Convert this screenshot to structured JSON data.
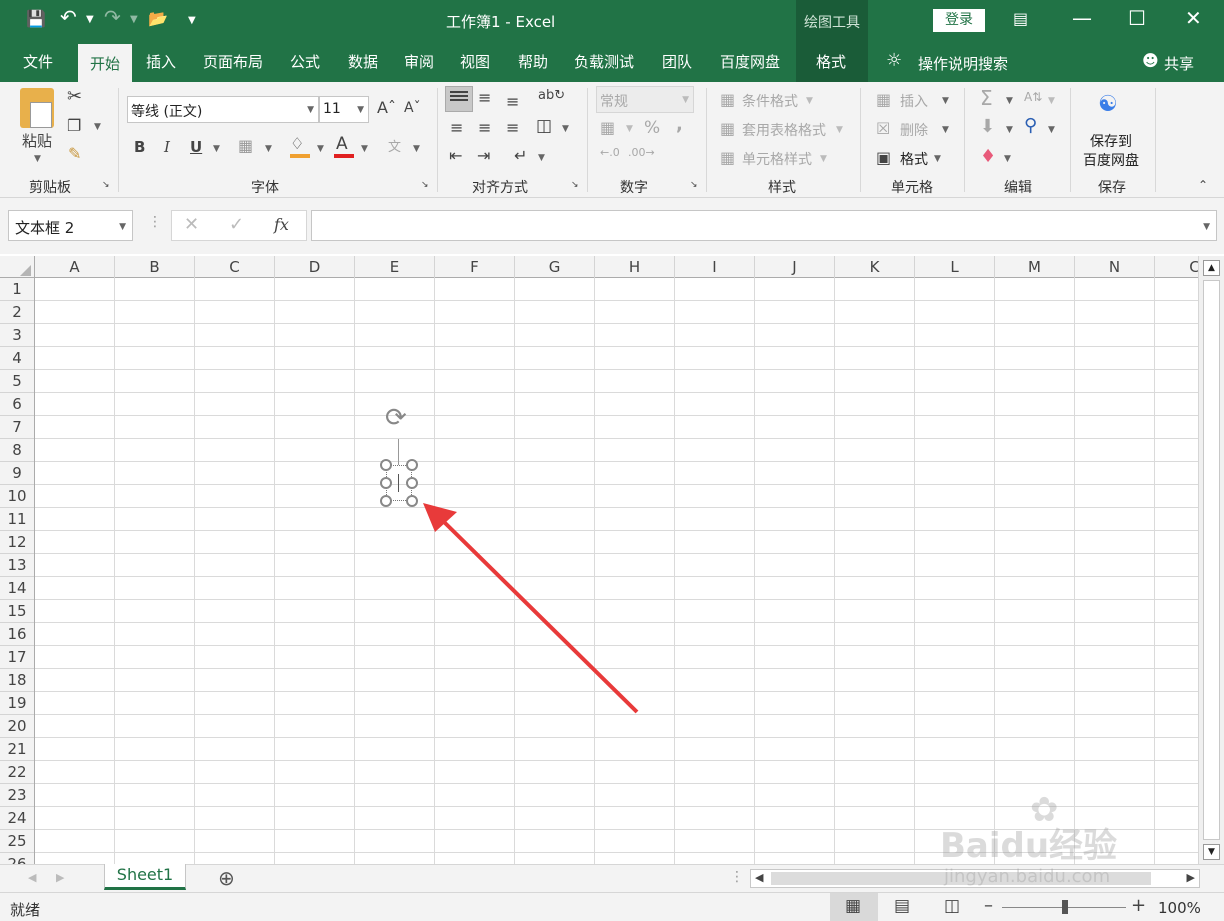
{
  "window": {
    "title": "工作簿1 - Excel",
    "context_tab_group": "绘图工具",
    "login_label": "登录"
  },
  "tabs": [
    "文件",
    "开始",
    "插入",
    "页面布局",
    "公式",
    "数据",
    "审阅",
    "视图",
    "帮助",
    "负载测试",
    "团队",
    "百度网盘",
    "格式"
  ],
  "active_tab": "开始",
  "tell_me": "操作说明搜索",
  "share_label": "共享",
  "ribbon": {
    "clipboard": {
      "paste": "粘贴",
      "group": "剪贴板"
    },
    "font": {
      "name": "等线 (正文)",
      "size": "11",
      "group": "字体",
      "bold": "B",
      "italic": "I",
      "underline": "U",
      "color_letter": "A"
    },
    "alignment": {
      "group": "对齐方式"
    },
    "number": {
      "format": "常规",
      "percent": "%",
      "comma": ",",
      "group": "数字"
    },
    "styles": {
      "conditional": "条件格式",
      "table": "套用表格格式",
      "cell_styles": "单元格样式",
      "group": "样式"
    },
    "cells": {
      "insert": "插入",
      "delete": "删除",
      "format": "格式",
      "group": "单元格"
    },
    "editing": {
      "group": "编辑"
    },
    "save": {
      "line1": "保存到",
      "line2": "百度网盘",
      "group": "保存"
    }
  },
  "name_box": "文本框 2",
  "fx_label": "fx",
  "columns": [
    "A",
    "B",
    "C",
    "D",
    "E",
    "F",
    "G",
    "H",
    "I",
    "J",
    "K",
    "L",
    "M",
    "N",
    "C"
  ],
  "rows": [
    "1",
    "2",
    "3",
    "4",
    "5",
    "6",
    "7",
    "8",
    "9",
    "10",
    "11",
    "12",
    "13",
    "14",
    "15",
    "16",
    "17",
    "18",
    "19",
    "20",
    "21",
    "22",
    "23",
    "24",
    "25",
    "26"
  ],
  "sheet_tab": "Sheet1",
  "status": {
    "ready": "就绪",
    "zoom": "100%"
  },
  "watermark": {
    "brand": "Baidu经验",
    "url": "jingyan.baidu.com"
  },
  "colors": {
    "excel_green": "#217346",
    "arrow_red": "#e83a3a"
  }
}
